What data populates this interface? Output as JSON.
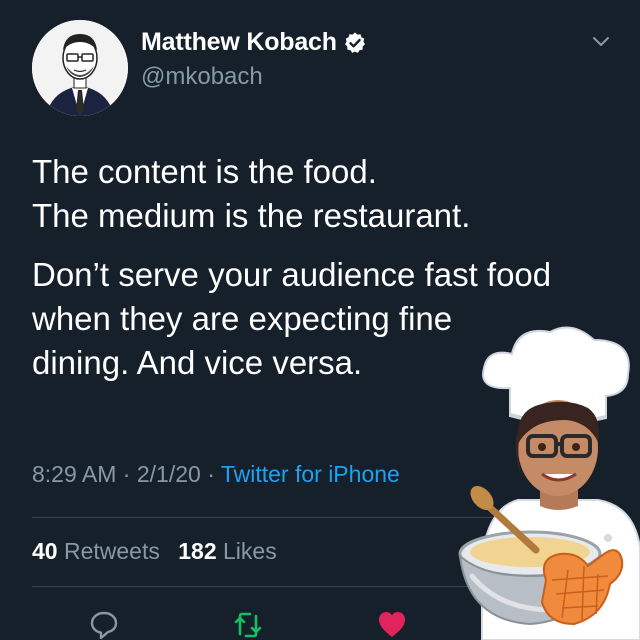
{
  "tweet": {
    "author": {
      "display_name": "Matthew Kobach",
      "handle": "@mkobach",
      "verified": true
    },
    "text": {
      "paragraph1_line1": "The content is the food.",
      "paragraph1_line2": "The medium is the restaurant.",
      "paragraph2_line1": "Don’t serve your audience fast food",
      "paragraph2_line2": "when they are expecting fine",
      "paragraph2_line3": "dining. And vice versa."
    },
    "meta": {
      "time": "8:29 AM",
      "separator": "·",
      "date": "2/1/20",
      "source": "Twitter for iPhone"
    },
    "stats": {
      "retweets_count": "40",
      "retweets_label": "Retweets",
      "likes_count": "182",
      "likes_label": "Likes"
    }
  },
  "icons": {
    "reply": "reply-icon",
    "retweet": "retweet-icon",
    "like": "heart-icon",
    "share": "share-icon",
    "more": "chevron-down-icon"
  },
  "colors": {
    "background": "#15202b",
    "primary_text": "#ffffff",
    "secondary_text": "#8899a6",
    "link": "#1da1f2",
    "retweet_green": "#17bf63",
    "like_red": "#e0245e"
  }
}
